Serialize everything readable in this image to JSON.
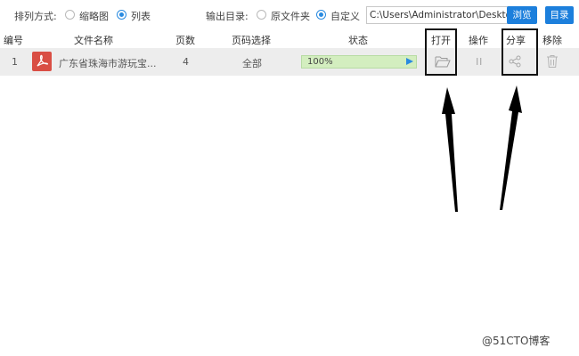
{
  "toolbar": {
    "sort_label": "排列方式:",
    "sort_options": [
      {
        "label": "缩略图",
        "checked": false
      },
      {
        "label": "列表",
        "checked": true
      }
    ],
    "output_label": "输出目录:",
    "output_options": [
      {
        "label": "原文件夹",
        "checked": false
      },
      {
        "label": "自定义",
        "checked": true
      }
    ],
    "path_value": "C:\\Users\\Administrator\\Desktop",
    "browse_label": "浏览",
    "folder_label": "目录"
  },
  "table": {
    "headers": [
      "编号",
      "文件名称",
      "页数",
      "页码选择",
      "状态",
      "打开",
      "操作",
      "分享",
      "移除"
    ],
    "rows": [
      {
        "index": "1",
        "file_icon": "pdf-file-icon",
        "file_name": "广东省珠海市游玩宝...",
        "pages": "4",
        "page_selection": "全部",
        "progress_text": "100%",
        "progress": 1.0,
        "open_icon": "folder-open-icon",
        "action_icon": "pause-icon",
        "share_icon": "share-icon",
        "remove_icon": "trash-icon"
      }
    ]
  },
  "annotations": {
    "highlighted_columns": [
      "打开",
      "分享"
    ],
    "arrow_count": 2,
    "color": "#000000"
  },
  "watermark": "@51CTO博客",
  "colors": {
    "accent": "#1c7fdc",
    "row_bg": "#ededed",
    "progress_bg": "#dff2cf",
    "pdf_red": "#d94e44"
  }
}
